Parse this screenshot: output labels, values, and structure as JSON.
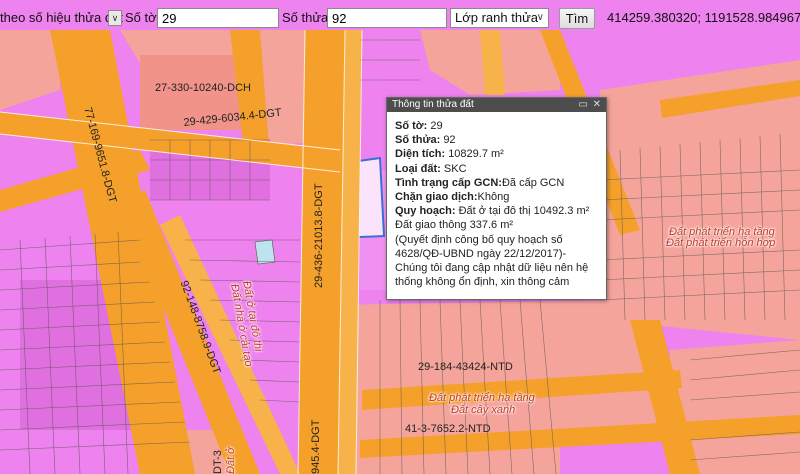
{
  "toolbar": {
    "search_mode_label": "theo số hiệu thửa đất",
    "dropdown_arrow": "∨",
    "so_to_label": "Số tờ:",
    "so_to_value": "29",
    "so_thua_label": "Số thửa:",
    "so_thua_value": "92",
    "layer_select_value": "Lớp ranh thửa",
    "search_button": "Tìm",
    "coordinates": "414259.380320; 1191528.984967"
  },
  "map_labels": [
    "27-330-10240-DCH",
    "29-429-6034.4-DGT",
    "77-169-9651.8-DGT",
    "29-436-21013.8-DGT",
    "92-148-8758.9-DGT",
    "29-184-43424-NTD",
    "41-3-7652.2-NTD",
    "945.4-DGT",
    "DT-3"
  ],
  "map_red_labels": [
    "Đất phát triển hạ tầng",
    "Đất phát triển hỗn hợp",
    "Đất ở tại đô thị",
    "Đất nhà ở cải tạo",
    "Đất phát triển hạ tầng",
    "Đất cây xanh",
    "Đất ở"
  ],
  "popup": {
    "title": "Thông tin thửa đất",
    "so_to_label": "Số tờ:",
    "so_to_value": "29",
    "so_thua_label": "Số thửa:",
    "so_thua_value": "92",
    "dien_tich_label": "Diện tích:",
    "dien_tich_value": "10829.7 m²",
    "loai_dat_label": "Loại đất:",
    "loai_dat_value": "SKC",
    "tinh_trang_label": "Tình trạng cấp GCN:",
    "tinh_trang_value": "Đã cấp GCN",
    "chan_label": "Chặn giao dịch:",
    "chan_value": "Không",
    "quy_hoach_label": "Quy hoạch:",
    "quy_hoach_value": "Đất ở tại đô thị 10492.3 m²",
    "quy_hoach_line2": "Đất giao thông 337.6 m²",
    "note_1": "(Quyết định công bố quy hoạch số",
    "note_2": "4628/QĐ-UBND ngày 22/12/2017)-",
    "note_3": "Chúng tôi đang cập nhật dữ liệu nên hệ",
    "note_4": "thống không ổn định, xin thông cảm"
  },
  "colors": {
    "residential": "#ee82ee",
    "infrastructure": "#f5a49c",
    "road": "#f5a02a",
    "selected_parcel": "#fbe3fb"
  }
}
